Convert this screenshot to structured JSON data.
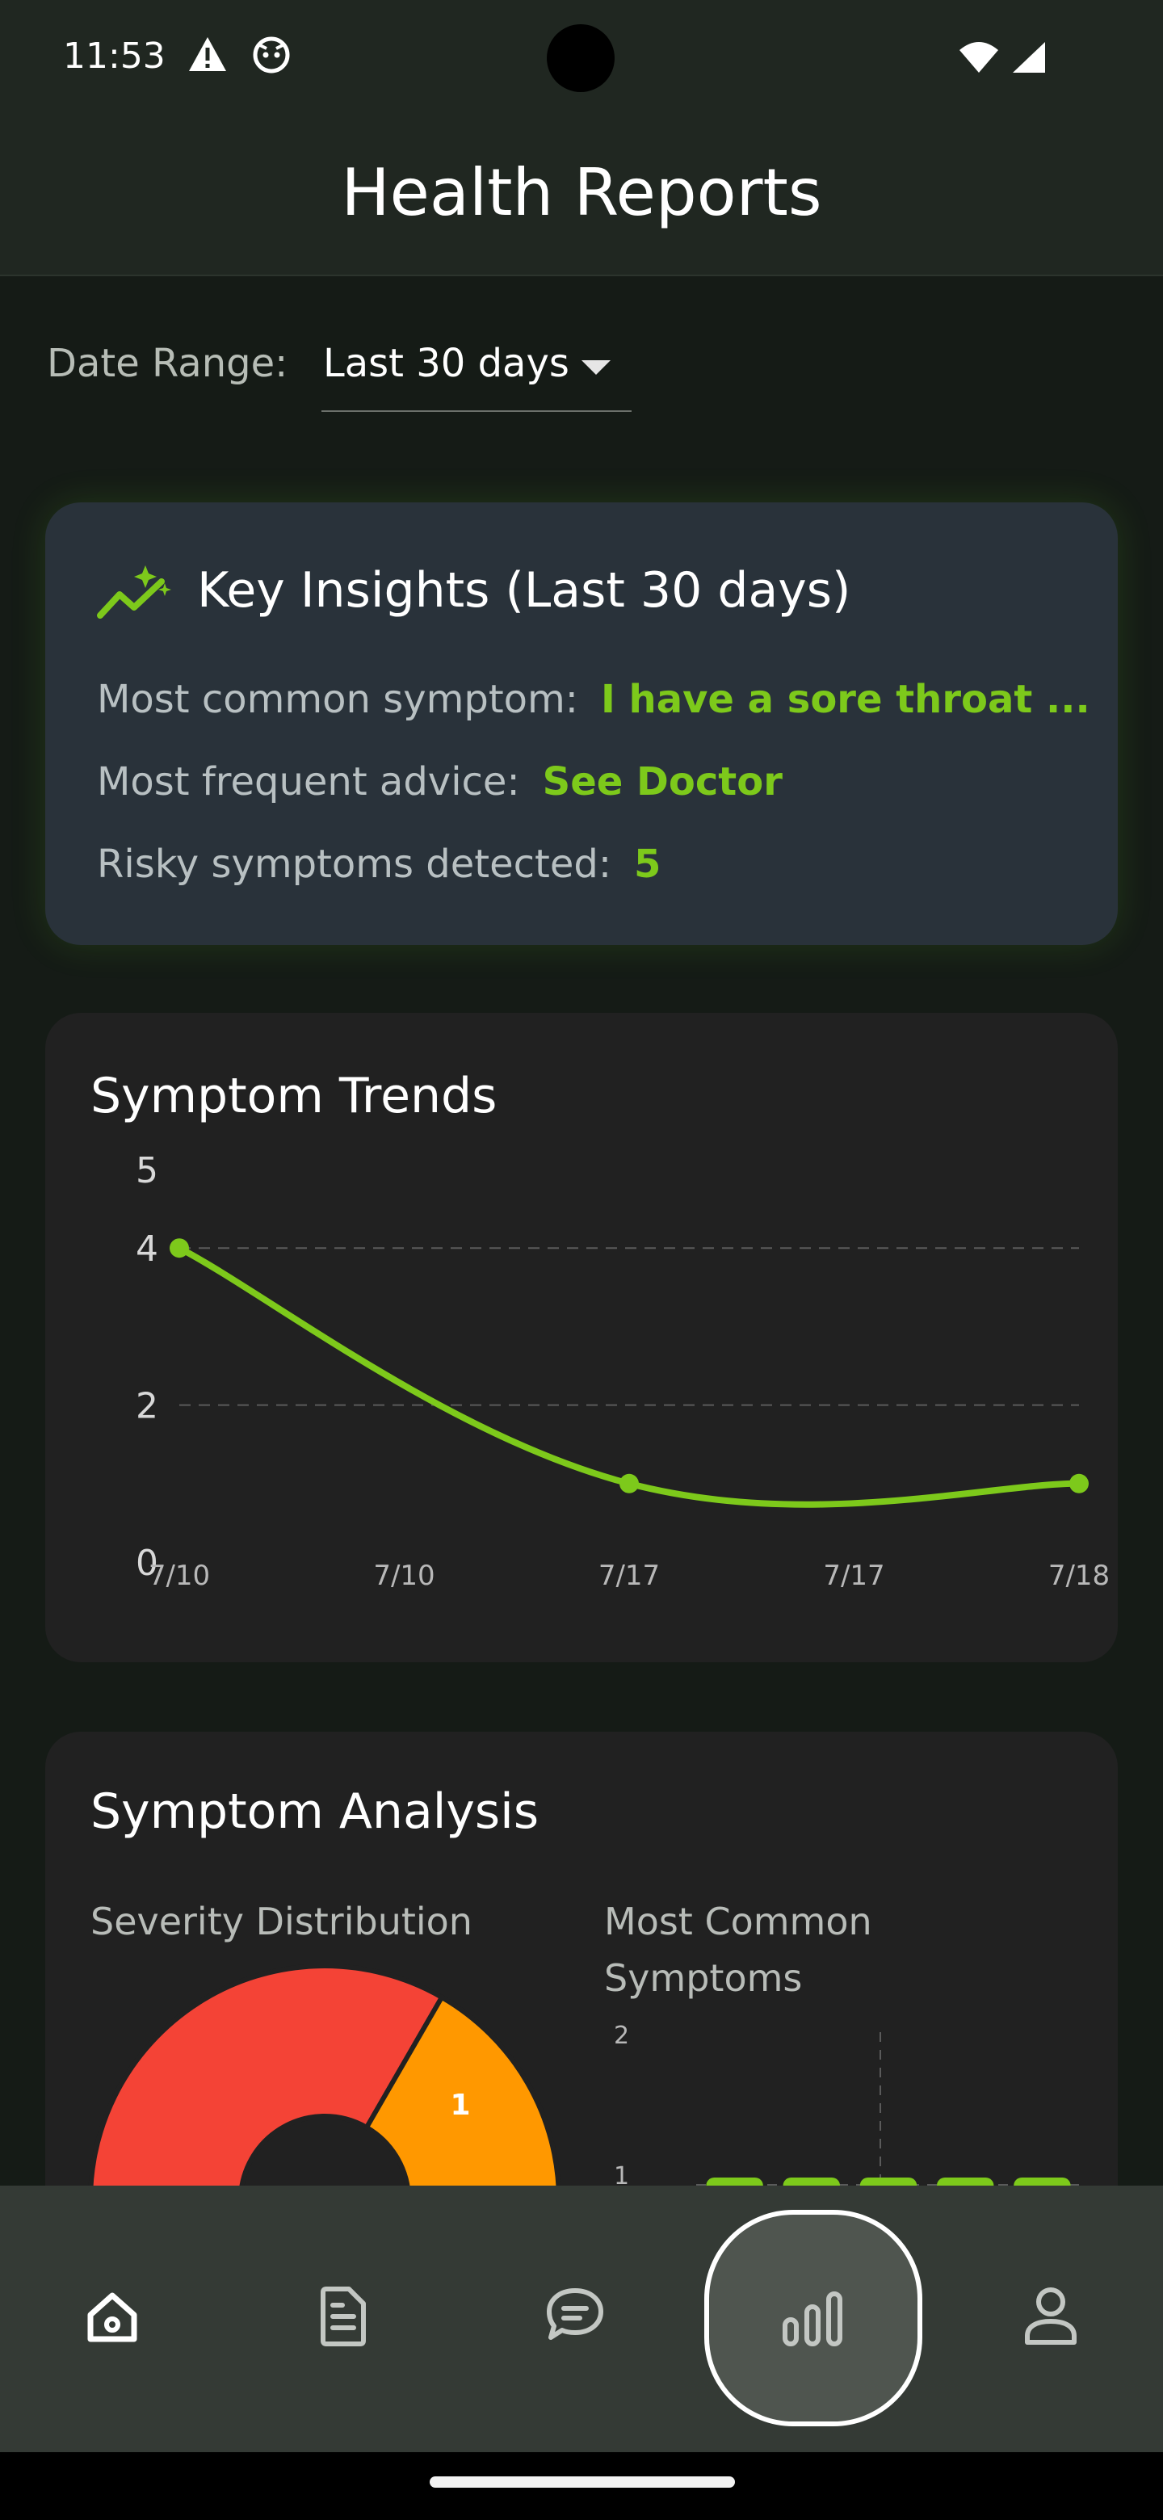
{
  "status_bar": {
    "time": "11:53",
    "icons": [
      "warning-icon",
      "android-face-icon",
      "wifi-icon",
      "cell-signal-icon"
    ]
  },
  "app_bar": {
    "title": "Health Reports"
  },
  "date_range": {
    "label": "Date Range:",
    "value": "Last 30 days"
  },
  "insights": {
    "title": "Key Insights (Last 30 days)",
    "rows": [
      {
        "label": "Most common symptom:",
        "value": "I have a sore throat ..."
      },
      {
        "label": "Most frequent advice:",
        "value": "See Doctor"
      },
      {
        "label": "Risky symptoms detected:",
        "value": "5"
      }
    ]
  },
  "colors": {
    "accent": "#7dc91b",
    "card_dark": "#212121",
    "card_insight": "#29323a",
    "severity_high": "#f44336",
    "severity_medium": "#ff9800"
  },
  "trends": {
    "title": "Symptom Trends",
    "chart_data": {
      "type": "line",
      "categories": [
        "7/10",
        "7/10",
        "7/17",
        "7/17",
        "7/18"
      ],
      "points": [
        {
          "x_index": 0,
          "y": 4
        },
        {
          "x_index": 2,
          "y": 1
        },
        {
          "x_index": 4,
          "y": 1
        }
      ],
      "y_ticks": [
        "0",
        "2",
        "4",
        "5"
      ],
      "ylim": [
        0,
        5
      ],
      "grid": true
    }
  },
  "analysis": {
    "title": "Symptom Analysis",
    "severity_label": "Severity Distribution",
    "common_label": "Most Common Symptoms",
    "severity_chart": {
      "type": "pie",
      "visible_slice_label": "1"
    },
    "common_chart": {
      "type": "bar",
      "y_ticks": [
        "2",
        "1"
      ],
      "values": [
        1,
        1,
        1,
        1,
        1
      ],
      "ylim": [
        0,
        2
      ]
    }
  },
  "nav": {
    "items": [
      {
        "icon": "home-icon",
        "active": false
      },
      {
        "icon": "document-icon",
        "active": false
      },
      {
        "icon": "chat-icon",
        "active": false
      },
      {
        "icon": "bar-chart-icon",
        "active": true
      },
      {
        "icon": "profile-icon",
        "active": false
      }
    ]
  }
}
